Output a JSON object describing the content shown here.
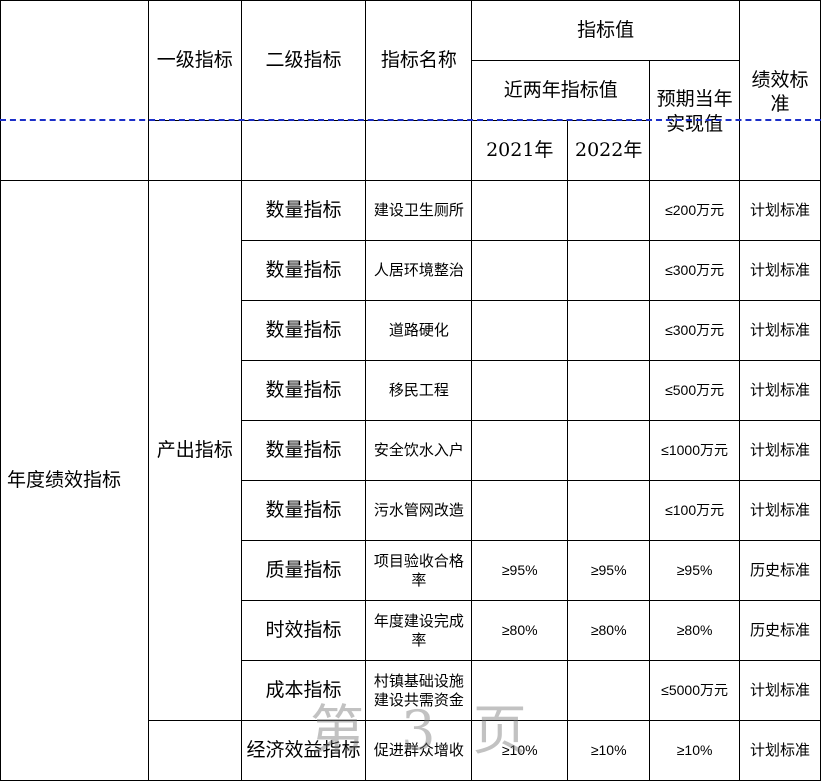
{
  "header": {
    "level1": "一级指标",
    "level2": "二级指标",
    "indicator_name": "指标名称",
    "indicator_value": "指标值",
    "recent_two_years": "近两年指标值",
    "expected": "预期当年实现值",
    "standard": "绩效标准",
    "year1": "2021年",
    "year2": "2022年"
  },
  "annual_label": "年度绩效指标",
  "output_label": "产出指标",
  "rows": [
    {
      "level2": "数量指标",
      "name": "建设卫生厕所",
      "y2021": "",
      "y2022": "",
      "expected": "≤200万元",
      "standard": "计划标准"
    },
    {
      "level2": "数量指标",
      "name": "人居环境整治",
      "y2021": "",
      "y2022": "",
      "expected": "≤300万元",
      "standard": "计划标准"
    },
    {
      "level2": "数量指标",
      "name": "道路硬化",
      "y2021": "",
      "y2022": "",
      "expected": "≤300万元",
      "standard": "计划标准"
    },
    {
      "level2": "数量指标",
      "name": "移民工程",
      "y2021": "",
      "y2022": "",
      "expected": "≤500万元",
      "standard": "计划标准"
    },
    {
      "level2": "数量指标",
      "name": "安全饮水入户",
      "y2021": "",
      "y2022": "",
      "expected": "≤1000万元",
      "standard": "计划标准"
    },
    {
      "level2": "数量指标",
      "name": "污水管网改造",
      "y2021": "",
      "y2022": "",
      "expected": "≤100万元",
      "standard": "计划标准"
    },
    {
      "level2": "质量指标",
      "name": "项目验收合格率",
      "y2021": "≥95%",
      "y2022": "≥95%",
      "expected": "≥95%",
      "standard": "历史标准"
    },
    {
      "level2": "时效指标",
      "name": "年度建设完成率",
      "y2021": "≥80%",
      "y2022": "≥80%",
      "expected": "≥80%",
      "standard": "历史标准"
    },
    {
      "level2": "成本指标",
      "name": "村镇基础设施建设共需资金",
      "y2021": "",
      "y2022": "",
      "expected": "≤5000万元",
      "standard": "计划标准"
    },
    {
      "level2": "经济效益指标",
      "name": "促进群众增收",
      "y2021": "≥10%",
      "y2022": "≥10%",
      "expected": "≥10%",
      "standard": "计划标准"
    }
  ],
  "watermark": "第 3 页",
  "colors": {
    "page_break_line": "#1c2fc8",
    "grid": "#000000",
    "watermark": "#787878"
  }
}
